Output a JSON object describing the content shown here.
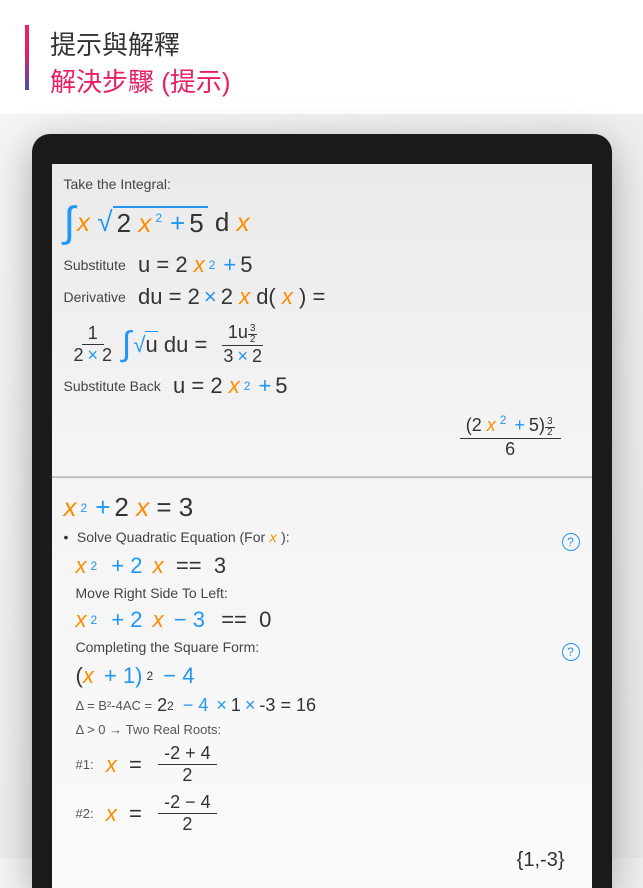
{
  "header": {
    "line1": "提示與解釋",
    "line2": "解決步驟 (提示)"
  },
  "integral": {
    "title": "Take the Integral:",
    "expr_coef": "2",
    "expr_const": "5",
    "sub_label": "Substitute",
    "sub_u": "u",
    "sub_eq": "=",
    "sub_rhs_coef": "2",
    "sub_rhs_const": "5",
    "deriv_label": "Derivative",
    "deriv_du": "du",
    "deriv_eq": "=",
    "deriv_2": "2",
    "deriv_2b": "2",
    "deriv_d": "d(",
    "deriv_close": ") =",
    "frac1_top": "1",
    "frac1_bot_a": "2",
    "frac1_bot_b": "2",
    "int_sqrt_u": "u",
    "int_du": "du",
    "res_eq": "=",
    "res_top": "1u",
    "res_exp_t": "3",
    "res_exp_b": "2",
    "res_bot_a": "3",
    "res_bot_b": "2",
    "subback_label": "Substitute Back",
    "subback_u": "u",
    "subback_eq": "=",
    "final_2": "2",
    "final_5": "5",
    "final_exp_t": "3",
    "final_exp_b": "2",
    "final_denom": "6"
  },
  "quadratic": {
    "problem_coef": "2",
    "problem_rhs": "3",
    "solve_label": "Solve Quadratic Equation (For",
    "solve_close": "):",
    "eq1_plus": "+ 2",
    "eq1_eqeq": "==",
    "eq1_rhs": "3",
    "move_label": "Move Right Side To Left:",
    "eq2_plus": "+ 2",
    "eq2_minus": "− 3",
    "eq2_eqeq": "==",
    "eq2_rhs": "0",
    "complete_label": "Completing the Square Form:",
    "sq_open": "(",
    "sq_plus1": "+ 1)",
    "sq_exp": "2",
    "sq_minus4": "− 4",
    "delta_label": "Δ = B²-4AC =",
    "delta_2": "2",
    "delta_sup2": "2",
    "delta_m4": "− 4",
    "delta_x1": "1",
    "delta_n3": "-3",
    "delta_eq16": "= 16",
    "roots_label": "Δ > 0 → Two Real Roots:",
    "r1_label": "#1:",
    "r1_top": "-2 + 4",
    "r1_bot": "2",
    "r2_label": "#2:",
    "r2_top": "-2 − 4",
    "r2_bot": "2",
    "answer": "{1,-3}"
  }
}
